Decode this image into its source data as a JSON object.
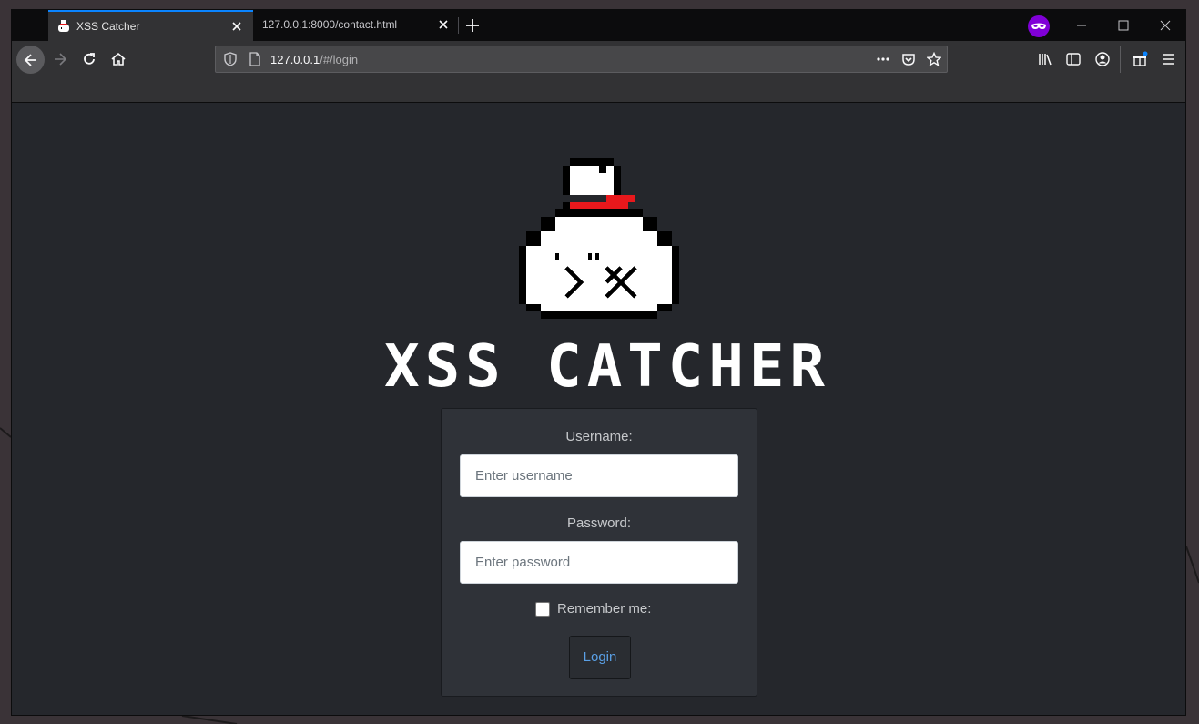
{
  "browser": {
    "tabs": [
      {
        "title": "XSS Catcher",
        "active": true,
        "favicon": "xss-catcher-bag-icon"
      },
      {
        "title": "127.0.0.1:8000/contact.html",
        "active": false
      }
    ],
    "url": {
      "host": "127.0.0.1",
      "path": "/#/login"
    },
    "colors": {
      "accent": "#0a84ff",
      "private_badge": "#8000d7"
    }
  },
  "page": {
    "brand_title": "XSS CATCHER",
    "form": {
      "username_label": "Username:",
      "username_placeholder": "Enter username",
      "password_label": "Password:",
      "password_placeholder": "Enter password",
      "remember_label": "Remember me:",
      "remember_checked": false,
      "login_label": "Login"
    },
    "colors": {
      "background": "#25272c",
      "card": "#2f3238",
      "button_text": "#5aa0e6",
      "ribbon": "#e8181c"
    }
  }
}
